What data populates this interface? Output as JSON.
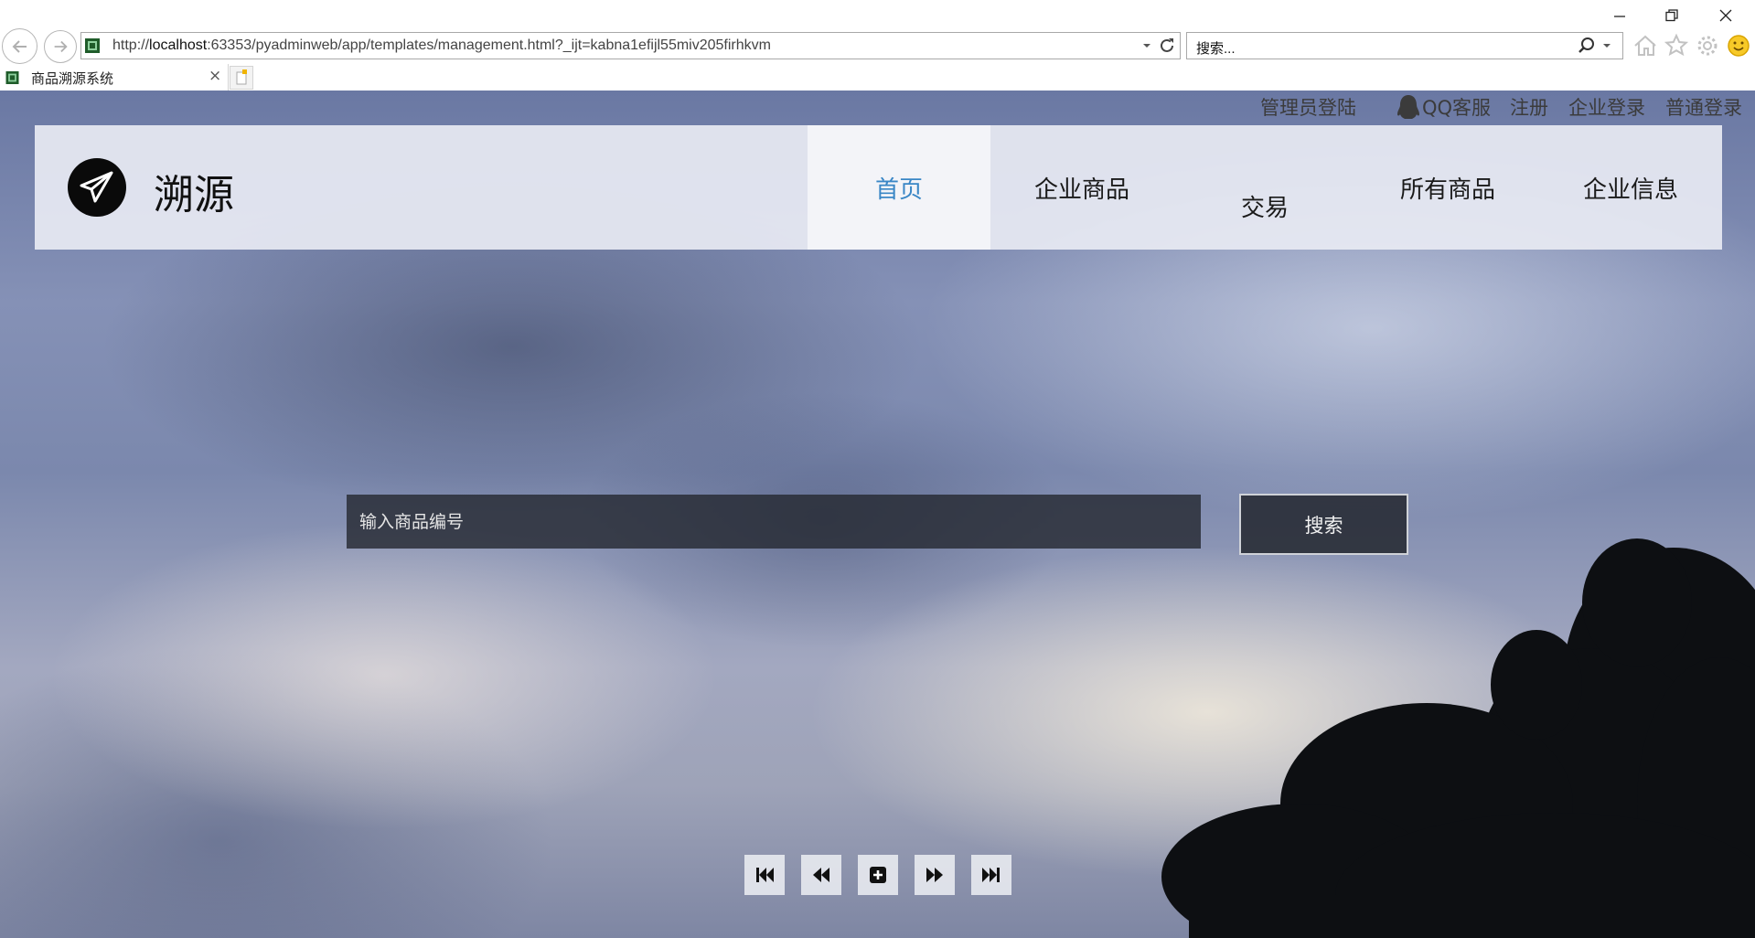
{
  "browser": {
    "url_prefix": "http://",
    "url_host": "localhost",
    "url_rest": ":63353/pyadminweb/app/templates/management.html?_ijt=kabna1efijl55miv205firhkvm",
    "search_placeholder": "搜索...",
    "tab_title": "商品溯源系统",
    "tab_close": "×"
  },
  "header_links": {
    "admin_login": "管理员登陆",
    "qq_service": "QQ客服",
    "register": "注册",
    "enterprise_login": "企业登录",
    "normal_login": "普通登录"
  },
  "brand": {
    "name": "溯源"
  },
  "nav": {
    "home": "首页",
    "enterprise_goods": "企业商品",
    "trade": "交易",
    "all_goods": "所有商品",
    "enterprise_info": "企业信息"
  },
  "search": {
    "placeholder": "输入商品编号",
    "button": "搜索"
  },
  "colors": {
    "nav_active_text": "#3a87c6",
    "nav_bar_bg": "#e8eaf3",
    "search_bg": "#262a32"
  },
  "icons": {
    "logo": "paper-plane-icon",
    "qq": "qq-penguin-icon",
    "controls": [
      "skip-first-icon",
      "rewind-icon",
      "plus-icon",
      "fast-forward-icon",
      "skip-last-icon"
    ]
  }
}
